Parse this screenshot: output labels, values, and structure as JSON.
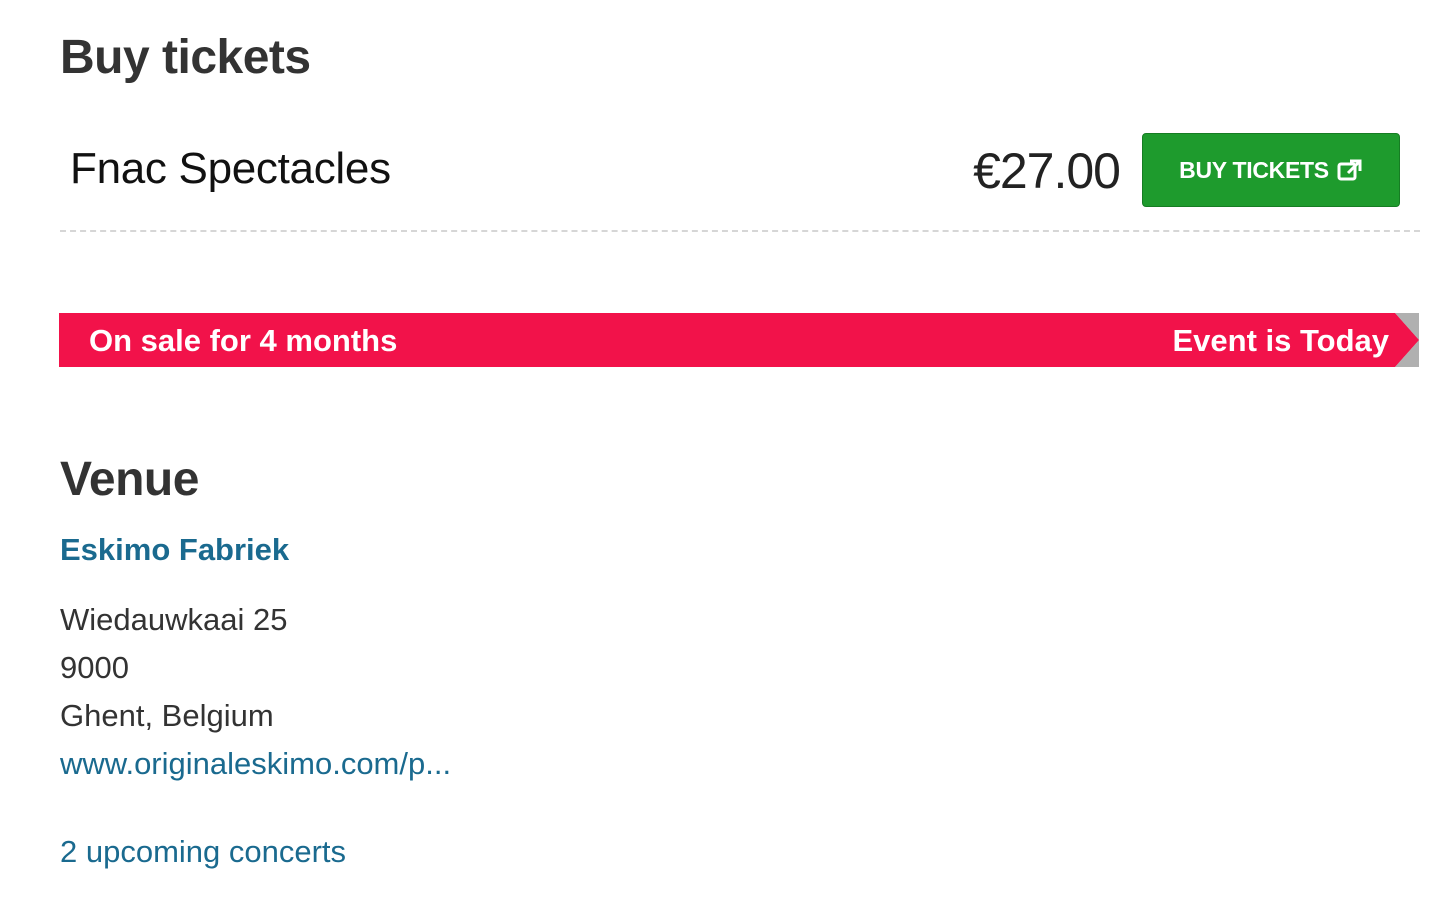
{
  "buy_section": {
    "title": "Buy tickets",
    "vendor": "Fnac Spectacles",
    "price": "€27.00",
    "button_label": "BUY TICKETS",
    "button_icon": "external-link-icon",
    "button_color": "#1e9b2d"
  },
  "sale_banner": {
    "left_text": "On sale for 4 months",
    "right_text": "Event is Today",
    "color": "#f2124a"
  },
  "venue_section": {
    "title": "Venue",
    "name": "Eskimo Fabriek",
    "street": "Wiedauwkaai 25",
    "postcode": "9000",
    "city": "Ghent, Belgium",
    "website": "www.originaleskimo.com/p...",
    "upcoming": "2 upcoming concerts",
    "link_color": "#1a6a8f"
  }
}
